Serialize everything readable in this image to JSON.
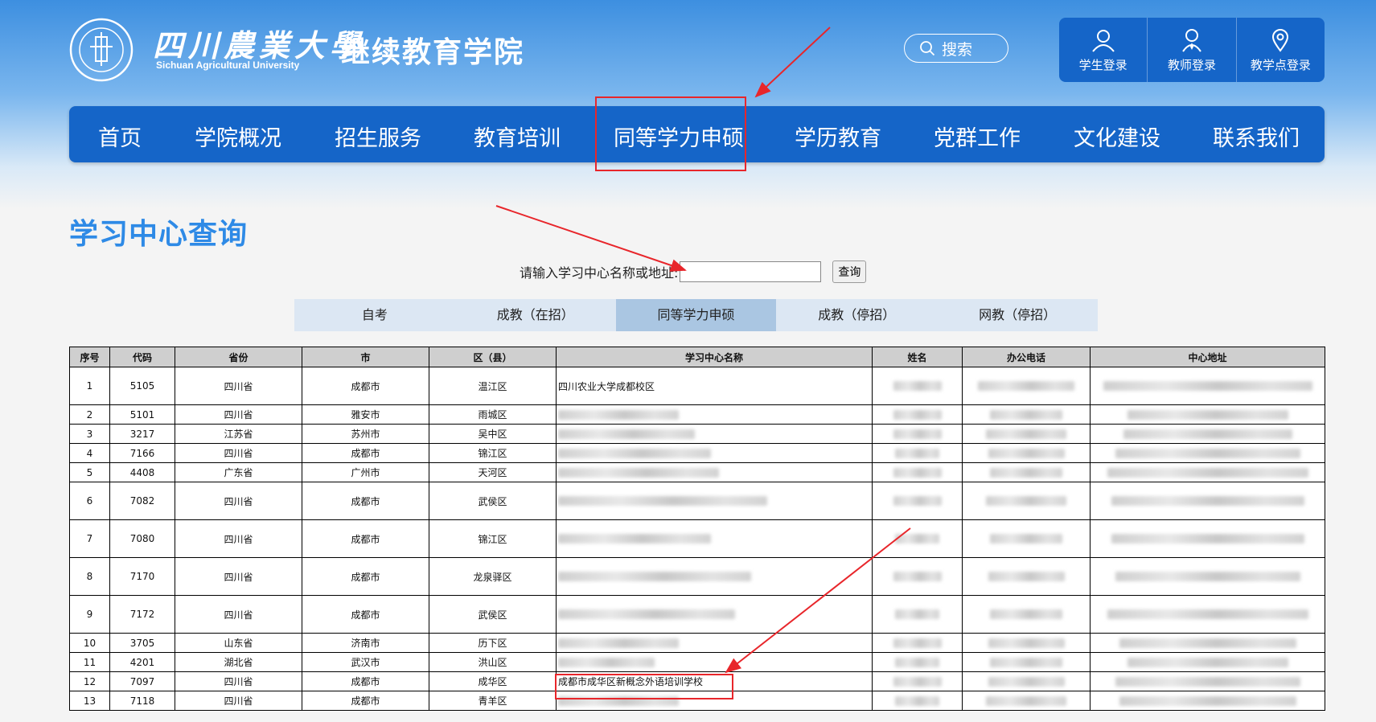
{
  "header": {
    "university_cn": "四川農業大學",
    "university_en": "Sichuan Agricultural University",
    "college": "继续教育学院",
    "search_label": "搜索",
    "logins": [
      {
        "label": "学生登录",
        "icon": "student-icon"
      },
      {
        "label": "教师登录",
        "icon": "teacher-icon"
      },
      {
        "label": "教学点登录",
        "icon": "location-pin-icon"
      }
    ]
  },
  "nav": {
    "items": [
      "首页",
      "学院概况",
      "招生服务",
      "教育培训",
      "同等学力申硕",
      "学历教育",
      "党群工作",
      "文化建设",
      "联系我们"
    ]
  },
  "page": {
    "title": "学习中心查询",
    "search_label": "请输入学习中心名称或地址:",
    "search_value": "",
    "search_button": "查询"
  },
  "tabs": {
    "items": [
      "自考",
      "成教（在招）",
      "同等学力申硕",
      "成教（停招）",
      "网教（停招）"
    ],
    "active_index": 2
  },
  "table": {
    "headers": [
      "序号",
      "代码",
      "省份",
      "市",
      "区（县）",
      "学习中心名称",
      "姓名",
      "办公电话",
      "中心地址"
    ],
    "rows": [
      {
        "no": "1",
        "code": "5105",
        "province": "四川省",
        "city": "成都市",
        "district": "温江区",
        "name": "四川农业大学成都校区"
      },
      {
        "no": "2",
        "code": "5101",
        "province": "四川省",
        "city": "雅安市",
        "district": "雨城区",
        "name": ""
      },
      {
        "no": "3",
        "code": "3217",
        "province": "江苏省",
        "city": "苏州市",
        "district": "吴中区",
        "name": ""
      },
      {
        "no": "4",
        "code": "7166",
        "province": "四川省",
        "city": "成都市",
        "district": "锦江区",
        "name": ""
      },
      {
        "no": "5",
        "code": "4408",
        "province": "广东省",
        "city": "广州市",
        "district": "天河区",
        "name": ""
      },
      {
        "no": "6",
        "code": "7082",
        "province": "四川省",
        "city": "成都市",
        "district": "武侯区",
        "name": ""
      },
      {
        "no": "7",
        "code": "7080",
        "province": "四川省",
        "city": "成都市",
        "district": "锦江区",
        "name": ""
      },
      {
        "no": "8",
        "code": "7170",
        "province": "四川省",
        "city": "成都市",
        "district": "龙泉驿区",
        "name": ""
      },
      {
        "no": "9",
        "code": "7172",
        "province": "四川省",
        "city": "成都市",
        "district": "武侯区",
        "name": ""
      },
      {
        "no": "10",
        "code": "3705",
        "province": "山东省",
        "city": "济南市",
        "district": "历下区",
        "name": ""
      },
      {
        "no": "11",
        "code": "4201",
        "province": "湖北省",
        "city": "武汉市",
        "district": "洪山区",
        "name": ""
      },
      {
        "no": "12",
        "code": "7097",
        "province": "四川省",
        "city": "成都市",
        "district": "成华区",
        "name": "成都市成华区新概念外语培训学校"
      },
      {
        "no": "13",
        "code": "7118",
        "province": "四川省",
        "city": "成都市",
        "district": "青羊区",
        "name": ""
      }
    ]
  },
  "colors": {
    "brand_blue": "#1565c8",
    "title_blue": "#2e8ae6",
    "annotation_red": "#e8262b",
    "tab_active": "#aac6e2"
  }
}
